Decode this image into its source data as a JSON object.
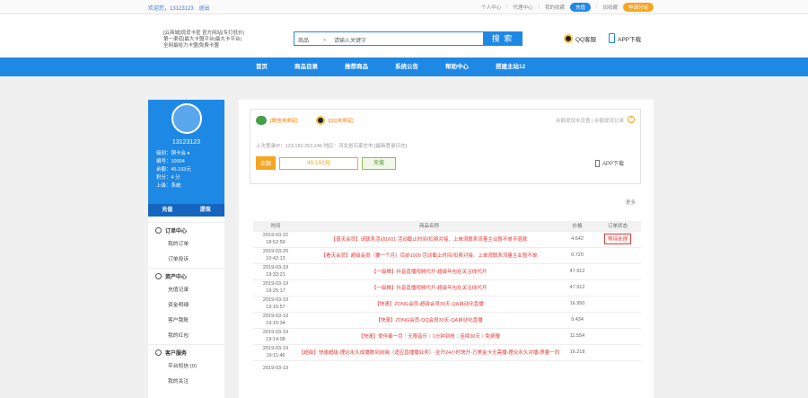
{
  "topbar": {
    "welcome": "欢迎您，13123123",
    "logout": "退出",
    "links": [
      "个人中心",
      "代理中心",
      "我的收藏"
    ],
    "pill_recharge": "充值",
    "bookmark": "加收藏",
    "pill_site": "申请分站"
  },
  "header": {
    "logo_alt": "[云商城]现货卡密 官方网站|专打低价|第一渠道|最大卡盟平台|最大卡平台|全网最给力卡盟|免费卡盟",
    "search": {
      "category": "商品",
      "placeholder": "请输入关键字",
      "button": "搜 索"
    },
    "qq_service": "QQ客服",
    "app_download": "APP下载"
  },
  "nav": [
    "首页",
    "商品目录",
    "推荐商品",
    "系统公告",
    "帮助中心",
    "搭建主站12"
  ],
  "profile": {
    "username": "13123123",
    "stats": [
      "级别：铜卡会 ♦",
      "编号：10004",
      "余额：45.193元",
      "积分：4 分",
      "上级：系统"
    ],
    "tab_recharge": "充值",
    "tab_withdraw": "提现"
  },
  "menu": [
    {
      "title": "订单中心",
      "icon": "cart-icon",
      "items": [
        "我的订单",
        "订单投诉"
      ]
    },
    {
      "title": "资产中心",
      "icon": "asset-icon",
      "items": [
        "充值记录",
        "资金明细",
        "客户我账",
        "我的红包"
      ]
    },
    {
      "title": "客户服务",
      "icon": "service-icon",
      "items": [
        "平台短信 (0)",
        "我的关注"
      ]
    }
  ],
  "card": {
    "wechat": "[微信未绑定]",
    "qq": "[QQ未绑定]",
    "right_text": "余额提现未设置 | 余额提现记录",
    "last_login": "上次登录IP：123.182.253.246 地区：河北省石家庄市 [最新登录日志]",
    "balance_label": "余额",
    "balance": "45.193元",
    "recharge": "充值",
    "app": "APP下载"
  },
  "more": "更多",
  "table": {
    "headers": [
      "时间",
      "商品名称",
      "价格",
      "订单状态"
    ],
    "rows": [
      {
        "date": "2019-03-22",
        "time": "18:52:59",
        "name": "【普天会员】请联系活动1601 活动截止时间/扣费对接、上单须联系流量主业暂不单不退款",
        "price": "4.642",
        "status": "等待处理"
      },
      {
        "date": "2019-03-20",
        "time": "10:42:13",
        "name": "【看天会员】超级会员（要一个月）目前1000 活动截止时间/扣费对接、上单须联系流量主业暂不单",
        "price": "0.720",
        "status": ""
      },
      {
        "date": "2019-03-19",
        "time": "19:32:21",
        "name": "【一级推】抖音直播视频代开-超级年包在关注线代开",
        "price": "47.912",
        "status": ""
      },
      {
        "date": "2019-03-19",
        "time": "19:25:17",
        "name": "【一级推】抖音直播视频代开-超级年包在关注线代开",
        "price": "47.912",
        "status": ""
      },
      {
        "date": "2019-03-19",
        "time": "19:15:57",
        "name": "【快速】ZONG会员-超级会员30天-QA自动化直播",
        "price": "16.950",
        "status": ""
      },
      {
        "date": "2019-03-19",
        "time": "19:15:34",
        "name": "【快速】ZONG会员-QQ会员30天-QA自动化直播",
        "price": "9.434",
        "status": ""
      },
      {
        "date": "2019-03-19",
        "time": "19:14:08",
        "name": "【快速】爱伴奏一月｜无限音乐｜1分钟到帐｜连续30天｜免费赠",
        "price": "11.554",
        "status": ""
      },
      {
        "date": "2019-03-19",
        "time": "19:11:46",
        "name": "【超级】快速超级-理论永久成播数到前端（适应直播播业务）-全开24小时快开-万美金卡无需播-理论永久对播-质量一同",
        "price": "16.218",
        "status": ""
      },
      {
        "date": "2019-03-19",
        "time": "",
        "name": "",
        "price": "",
        "status": ""
      }
    ]
  }
}
